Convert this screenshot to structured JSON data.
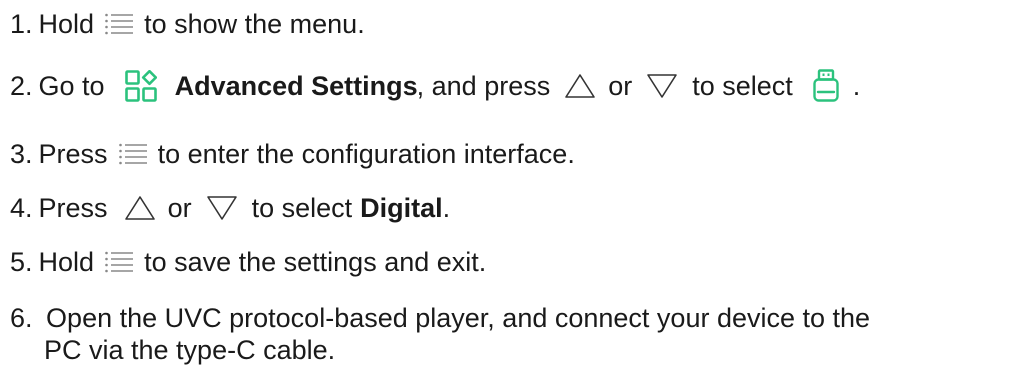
{
  "accent_color": "#2bc27d",
  "steps": [
    {
      "num": "1.",
      "a": "Hold",
      "b": "to show the menu."
    },
    {
      "num": "2.",
      "a": "Go to",
      "b": "Advanced Settings",
      "c": ", and press",
      "d": "or",
      "e": "to select",
      "f": "."
    },
    {
      "num": "3.",
      "a": "Press",
      "b": "to enter the configuration interface."
    },
    {
      "num": "4.",
      "a": "Press",
      "b": "or",
      "c": "to select",
      "d": "Digital",
      "e": "."
    },
    {
      "num": "5.",
      "a": "Hold",
      "b": "to save the settings and exit."
    },
    {
      "num": "6.",
      "a": "Open the UVC protocol-based player, and connect your device to the",
      "b": "PC via the type-C cable."
    }
  ],
  "icons": {
    "menu": "menu-icon",
    "advanced_settings": "advanced-settings-icon",
    "up": "up-triangle-icon",
    "down": "down-triangle-icon",
    "usb": "usb-device-icon"
  }
}
